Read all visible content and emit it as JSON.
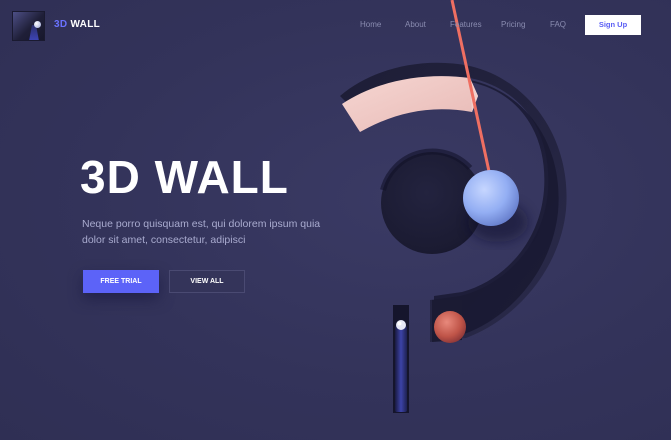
{
  "header": {
    "brand_accent": "3D",
    "brand_name": "WALL",
    "nav": [
      "Home",
      "About",
      "Features",
      "Pricing",
      "FAQ"
    ],
    "signup_label": "Sign Up"
  },
  "hero": {
    "title": "3D WALL",
    "subtitle": "Neque porro quisquam est, qui dolorem ipsum quia dolor sit amet, consectetur, adipisci",
    "primary_button": "FREE TRIAL",
    "secondary_button": "VIEW ALL"
  },
  "colors": {
    "background": "#34345a",
    "accent": "#5c63f8",
    "brand_accent": "#6a72ff",
    "pink_arc": "#f0c9c5",
    "pendulum_string": "#ef6f62",
    "blue_ball": "#9bb4f6",
    "red_ball": "#c9594c"
  },
  "icons": {
    "logo": "3d-wall-logo-icon"
  }
}
